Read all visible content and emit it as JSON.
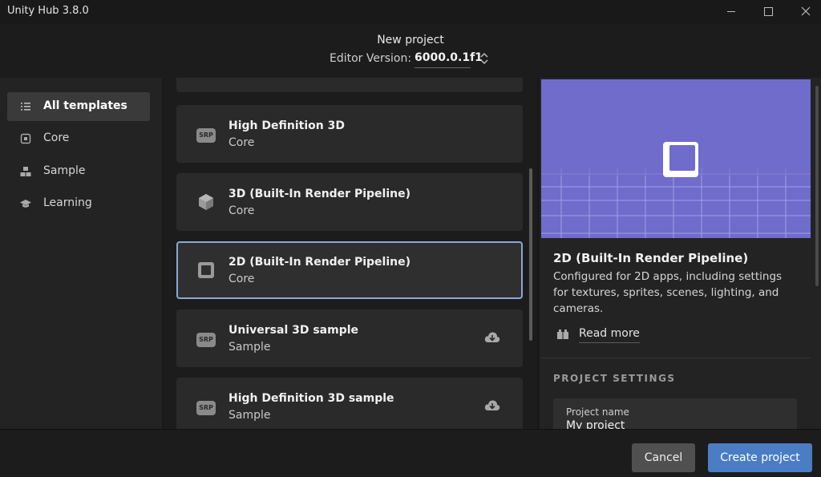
{
  "window": {
    "title": "Unity Hub 3.8.0"
  },
  "header": {
    "title": "New project",
    "editor_version_label": "Editor Version:",
    "editor_version_value": "6000.0.1f1"
  },
  "sidebar": {
    "items": [
      {
        "label": "All templates",
        "icon": "list-icon",
        "active": true
      },
      {
        "label": "Core",
        "icon": "core-icon",
        "active": false
      },
      {
        "label": "Sample",
        "icon": "sample-icon",
        "active": false
      },
      {
        "label": "Learning",
        "icon": "learning-icon",
        "active": false
      }
    ]
  },
  "templates": [
    {
      "title": "High Definition 3D",
      "category": "Core",
      "icon": "srp-badge",
      "download": false
    },
    {
      "title": "3D (Built-In Render Pipeline)",
      "category": "Core",
      "icon": "cube-icon",
      "download": false
    },
    {
      "title": "2D (Built-In Render Pipeline)",
      "category": "Core",
      "icon": "square-icon",
      "download": false,
      "selected": true
    },
    {
      "title": "Universal 3D sample",
      "category": "Sample",
      "icon": "srp-badge",
      "download": true
    },
    {
      "title": "High Definition 3D sample",
      "category": "Sample",
      "icon": "srp-badge",
      "download": true
    }
  ],
  "srp_badge_text": "SRP",
  "detail": {
    "title": "2D (Built-In Render Pipeline)",
    "description": "Configured for 2D apps, including settings for textures, sprites, scenes, lighting, and cameras.",
    "read_more": "Read more",
    "section_heading": "PROJECT SETTINGS",
    "project_name_label": "Project name",
    "project_name_value": "My project",
    "preview_color": "#6f6ccc"
  },
  "footer": {
    "cancel": "Cancel",
    "create": "Create project"
  },
  "colors": {
    "accent": "#4a7dc4",
    "selected_border": "#8aa8d9"
  }
}
